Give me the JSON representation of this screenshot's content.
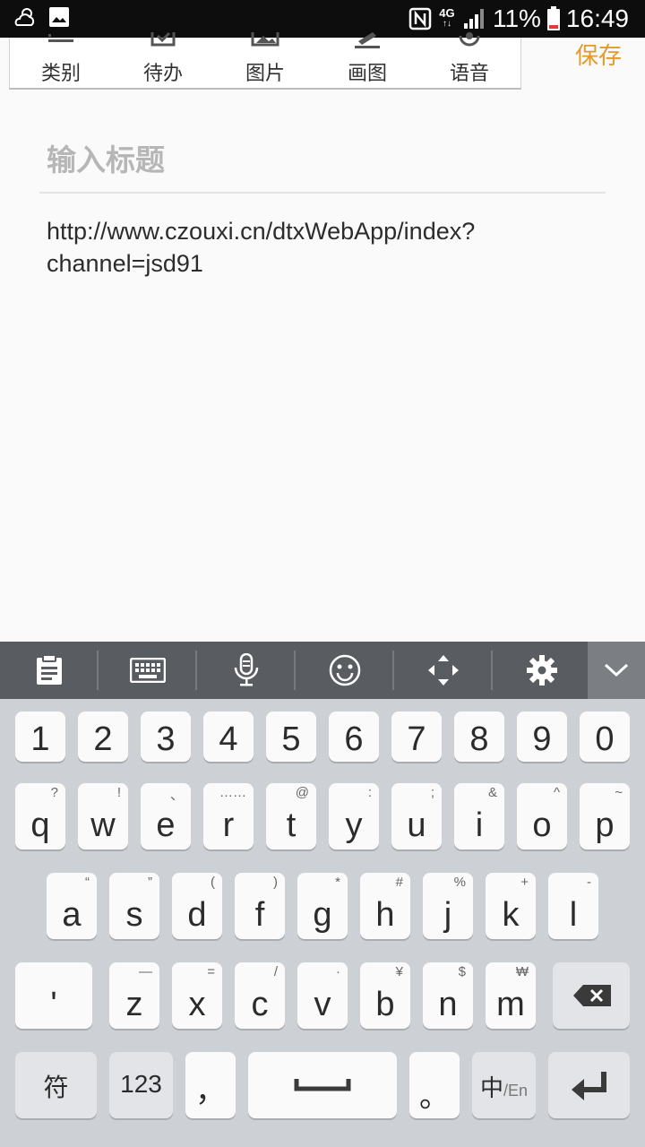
{
  "status_bar": {
    "icons": [
      "weather-icon",
      "gallery-notification-icon",
      "nfc-icon",
      "signal-icon",
      "battery-icon"
    ],
    "network": [
      "4G",
      "↑↓"
    ],
    "battery_text": "11%",
    "time": "16:49"
  },
  "toolbar": {
    "items": [
      {
        "label": "类别",
        "icon": "category-icon"
      },
      {
        "label": "待办",
        "icon": "todo-icon"
      },
      {
        "label": "图片",
        "icon": "image-icon"
      },
      {
        "label": "画图",
        "icon": "draw-icon"
      },
      {
        "label": "语音",
        "icon": "voice-icon"
      }
    ],
    "save_label": "保存"
  },
  "note": {
    "title_placeholder": "输入标题",
    "body_line1": "http://www.czouxi.cn/dtxWebApp/index?",
    "body_line2": "channel=jsd91"
  },
  "keyboard": {
    "toolbar_icons": [
      "clipboard-icon",
      "keyboard-icon",
      "microphone-icon",
      "emoji-icon",
      "cursor-move-icon",
      "settings-icon",
      "collapse-keyboard-icon"
    ],
    "numbers": [
      "1",
      "2",
      "3",
      "4",
      "5",
      "6",
      "7",
      "8",
      "9",
      "0"
    ],
    "row1": {
      "keys": [
        "q",
        "w",
        "e",
        "r",
        "t",
        "y",
        "u",
        "i",
        "o",
        "p"
      ],
      "subs": [
        "?",
        "!",
        "、",
        "……",
        "@",
        ":",
        ";",
        "&",
        "^",
        "~"
      ]
    },
    "row2": {
      "keys": [
        "a",
        "s",
        "d",
        "f",
        "g",
        "h",
        "j",
        "k",
        "l"
      ],
      "subs": [
        "“",
        "”",
        "(",
        ")",
        "*",
        "#",
        "%",
        "+",
        "-"
      ]
    },
    "row3": {
      "apostrophe": "'",
      "keys": [
        "z",
        "x",
        "c",
        "v",
        "b",
        "n",
        "m"
      ],
      "subs": [
        "—",
        "=",
        "/",
        "·",
        "¥",
        "$",
        "₩"
      ]
    },
    "bottom": {
      "symbols": "符",
      "num": "123",
      "comma": "，",
      "period": "。",
      "lang_main": "中",
      "lang_sub": "/En"
    },
    "colors": {
      "background": "#cdd1d6",
      "key": "#fafafa",
      "toolbar": "#595d62",
      "accent": "#e39a26"
    }
  }
}
